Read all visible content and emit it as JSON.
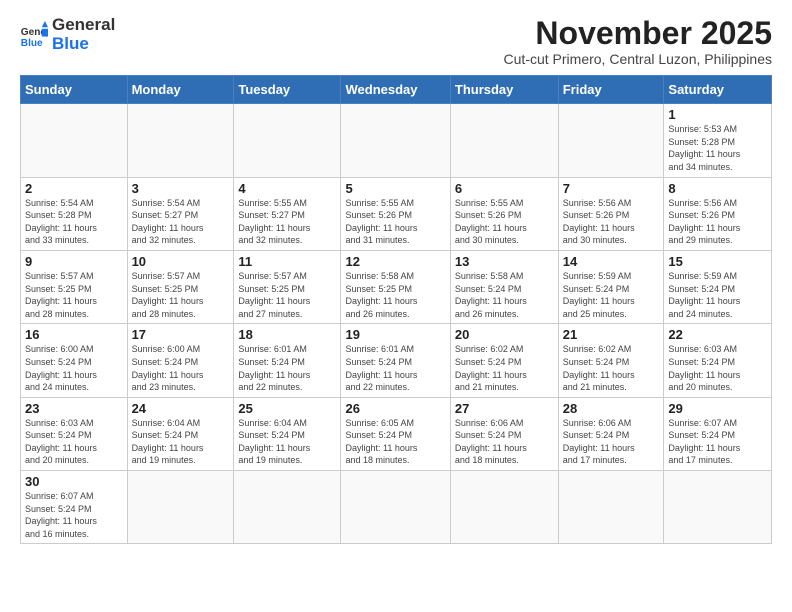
{
  "logo": {
    "line1": "General",
    "line2": "Blue"
  },
  "header": {
    "title": "November 2025",
    "subtitle": "Cut-cut Primero, Central Luzon, Philippines"
  },
  "weekdays": [
    "Sunday",
    "Monday",
    "Tuesday",
    "Wednesday",
    "Thursday",
    "Friday",
    "Saturday"
  ],
  "weeks": [
    [
      {
        "day": "",
        "info": ""
      },
      {
        "day": "",
        "info": ""
      },
      {
        "day": "",
        "info": ""
      },
      {
        "day": "",
        "info": ""
      },
      {
        "day": "",
        "info": ""
      },
      {
        "day": "",
        "info": ""
      },
      {
        "day": "1",
        "info": "Sunrise: 5:53 AM\nSunset: 5:28 PM\nDaylight: 11 hours\nand 34 minutes."
      }
    ],
    [
      {
        "day": "2",
        "info": "Sunrise: 5:54 AM\nSunset: 5:28 PM\nDaylight: 11 hours\nand 33 minutes."
      },
      {
        "day": "3",
        "info": "Sunrise: 5:54 AM\nSunset: 5:27 PM\nDaylight: 11 hours\nand 32 minutes."
      },
      {
        "day": "4",
        "info": "Sunrise: 5:55 AM\nSunset: 5:27 PM\nDaylight: 11 hours\nand 32 minutes."
      },
      {
        "day": "5",
        "info": "Sunrise: 5:55 AM\nSunset: 5:26 PM\nDaylight: 11 hours\nand 31 minutes."
      },
      {
        "day": "6",
        "info": "Sunrise: 5:55 AM\nSunset: 5:26 PM\nDaylight: 11 hours\nand 30 minutes."
      },
      {
        "day": "7",
        "info": "Sunrise: 5:56 AM\nSunset: 5:26 PM\nDaylight: 11 hours\nand 30 minutes."
      },
      {
        "day": "8",
        "info": "Sunrise: 5:56 AM\nSunset: 5:26 PM\nDaylight: 11 hours\nand 29 minutes."
      }
    ],
    [
      {
        "day": "9",
        "info": "Sunrise: 5:57 AM\nSunset: 5:25 PM\nDaylight: 11 hours\nand 28 minutes."
      },
      {
        "day": "10",
        "info": "Sunrise: 5:57 AM\nSunset: 5:25 PM\nDaylight: 11 hours\nand 28 minutes."
      },
      {
        "day": "11",
        "info": "Sunrise: 5:57 AM\nSunset: 5:25 PM\nDaylight: 11 hours\nand 27 minutes."
      },
      {
        "day": "12",
        "info": "Sunrise: 5:58 AM\nSunset: 5:25 PM\nDaylight: 11 hours\nand 26 minutes."
      },
      {
        "day": "13",
        "info": "Sunrise: 5:58 AM\nSunset: 5:24 PM\nDaylight: 11 hours\nand 26 minutes."
      },
      {
        "day": "14",
        "info": "Sunrise: 5:59 AM\nSunset: 5:24 PM\nDaylight: 11 hours\nand 25 minutes."
      },
      {
        "day": "15",
        "info": "Sunrise: 5:59 AM\nSunset: 5:24 PM\nDaylight: 11 hours\nand 24 minutes."
      }
    ],
    [
      {
        "day": "16",
        "info": "Sunrise: 6:00 AM\nSunset: 5:24 PM\nDaylight: 11 hours\nand 24 minutes."
      },
      {
        "day": "17",
        "info": "Sunrise: 6:00 AM\nSunset: 5:24 PM\nDaylight: 11 hours\nand 23 minutes."
      },
      {
        "day": "18",
        "info": "Sunrise: 6:01 AM\nSunset: 5:24 PM\nDaylight: 11 hours\nand 22 minutes."
      },
      {
        "day": "19",
        "info": "Sunrise: 6:01 AM\nSunset: 5:24 PM\nDaylight: 11 hours\nand 22 minutes."
      },
      {
        "day": "20",
        "info": "Sunrise: 6:02 AM\nSunset: 5:24 PM\nDaylight: 11 hours\nand 21 minutes."
      },
      {
        "day": "21",
        "info": "Sunrise: 6:02 AM\nSunset: 5:24 PM\nDaylight: 11 hours\nand 21 minutes."
      },
      {
        "day": "22",
        "info": "Sunrise: 6:03 AM\nSunset: 5:24 PM\nDaylight: 11 hours\nand 20 minutes."
      }
    ],
    [
      {
        "day": "23",
        "info": "Sunrise: 6:03 AM\nSunset: 5:24 PM\nDaylight: 11 hours\nand 20 minutes."
      },
      {
        "day": "24",
        "info": "Sunrise: 6:04 AM\nSunset: 5:24 PM\nDaylight: 11 hours\nand 19 minutes."
      },
      {
        "day": "25",
        "info": "Sunrise: 6:04 AM\nSunset: 5:24 PM\nDaylight: 11 hours\nand 19 minutes."
      },
      {
        "day": "26",
        "info": "Sunrise: 6:05 AM\nSunset: 5:24 PM\nDaylight: 11 hours\nand 18 minutes."
      },
      {
        "day": "27",
        "info": "Sunrise: 6:06 AM\nSunset: 5:24 PM\nDaylight: 11 hours\nand 18 minutes."
      },
      {
        "day": "28",
        "info": "Sunrise: 6:06 AM\nSunset: 5:24 PM\nDaylight: 11 hours\nand 17 minutes."
      },
      {
        "day": "29",
        "info": "Sunrise: 6:07 AM\nSunset: 5:24 PM\nDaylight: 11 hours\nand 17 minutes."
      }
    ],
    [
      {
        "day": "30",
        "info": "Sunrise: 6:07 AM\nSunset: 5:24 PM\nDaylight: 11 hours\nand 16 minutes."
      },
      {
        "day": "",
        "info": ""
      },
      {
        "day": "",
        "info": ""
      },
      {
        "day": "",
        "info": ""
      },
      {
        "day": "",
        "info": ""
      },
      {
        "day": "",
        "info": ""
      },
      {
        "day": "",
        "info": ""
      }
    ]
  ]
}
